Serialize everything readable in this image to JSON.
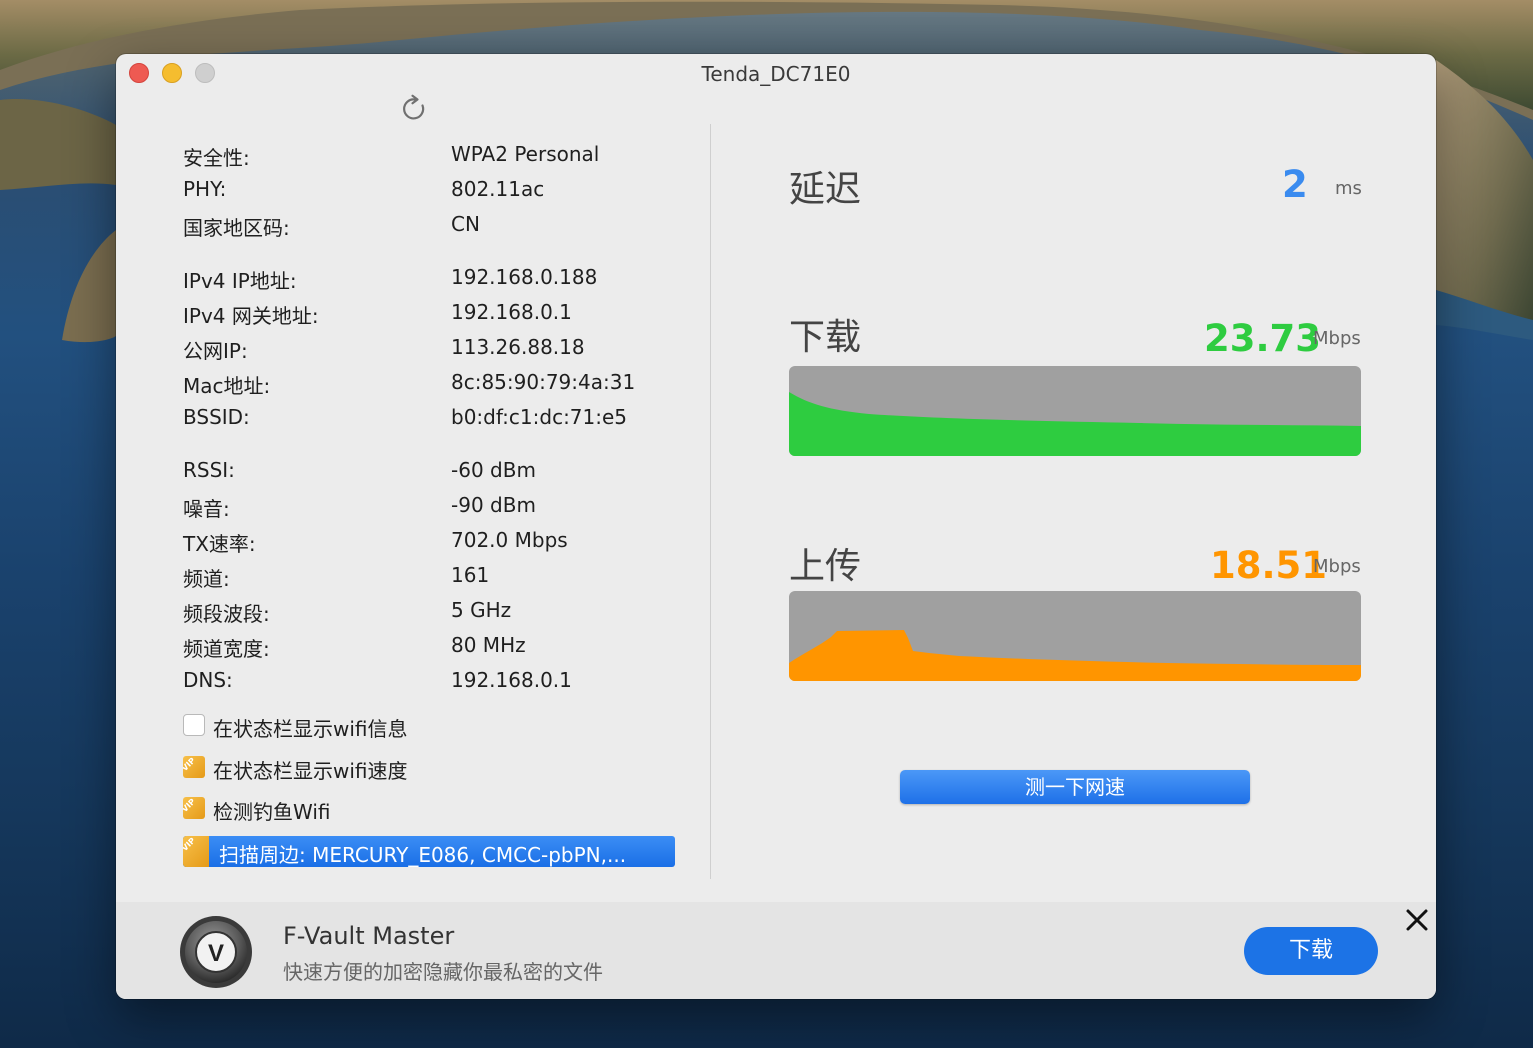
{
  "window": {
    "title": "Tenda_DC71E0"
  },
  "info": [
    {
      "key": "安全性:",
      "value": "WPA2 Personal"
    },
    {
      "key": "PHY:",
      "value": "802.11ac"
    },
    {
      "key": "国家地区码:",
      "value": "CN"
    },
    {
      "key": "IPv4 IP地址:",
      "value": "192.168.0.188"
    },
    {
      "key": "IPv4 网关地址:",
      "value": "192.168.0.1"
    },
    {
      "key": "公网IP:",
      "value": "113.26.88.18"
    },
    {
      "key": "Mac地址:",
      "value": "8c:85:90:79:4a:31"
    },
    {
      "key": "BSSID:",
      "value": "b0:df:c1:dc:71:e5"
    },
    {
      "key": "RSSI:",
      "value": "-60 dBm"
    },
    {
      "key": "噪音:",
      "value": "-90 dBm"
    },
    {
      "key": "TX速率:",
      "value": "702.0 Mbps"
    },
    {
      "key": "频道:",
      "value": "161"
    },
    {
      "key": "频段波段:",
      "value": "5 GHz"
    },
    {
      "key": "频道宽度:",
      "value": "80 MHz"
    },
    {
      "key": "DNS:",
      "value": "192.168.0.1"
    }
  ],
  "options": [
    {
      "label": "在状态栏显示wifi信息",
      "checked": false,
      "vip": false
    },
    {
      "label": "在状态栏显示wifi速度",
      "checked": true,
      "vip": true
    },
    {
      "label": "检测钓鱼Wifi",
      "checked": true,
      "vip": true
    }
  ],
  "scan": {
    "text": "扫描周边: MERCURY_E086, CMCC-pbPN,...",
    "vip_badge": "VIP"
  },
  "vip_badge": "VIP",
  "latency": {
    "label": "延迟",
    "value": "2",
    "unit": "ms",
    "color": "#3a8bef"
  },
  "download": {
    "label": "下载",
    "value": "23.73",
    "unit": "Mbps",
    "color": "#2ecc40"
  },
  "upload": {
    "label": "上传",
    "value": "18.51",
    "unit": "Mbps",
    "color": "#ff9500"
  },
  "speed_test_button": "测一下网速",
  "ad": {
    "title": "F-Vault Master",
    "subtitle": "快速方便的加密隐藏你最私密的文件",
    "button": "下载",
    "logo_letter": "V"
  }
}
